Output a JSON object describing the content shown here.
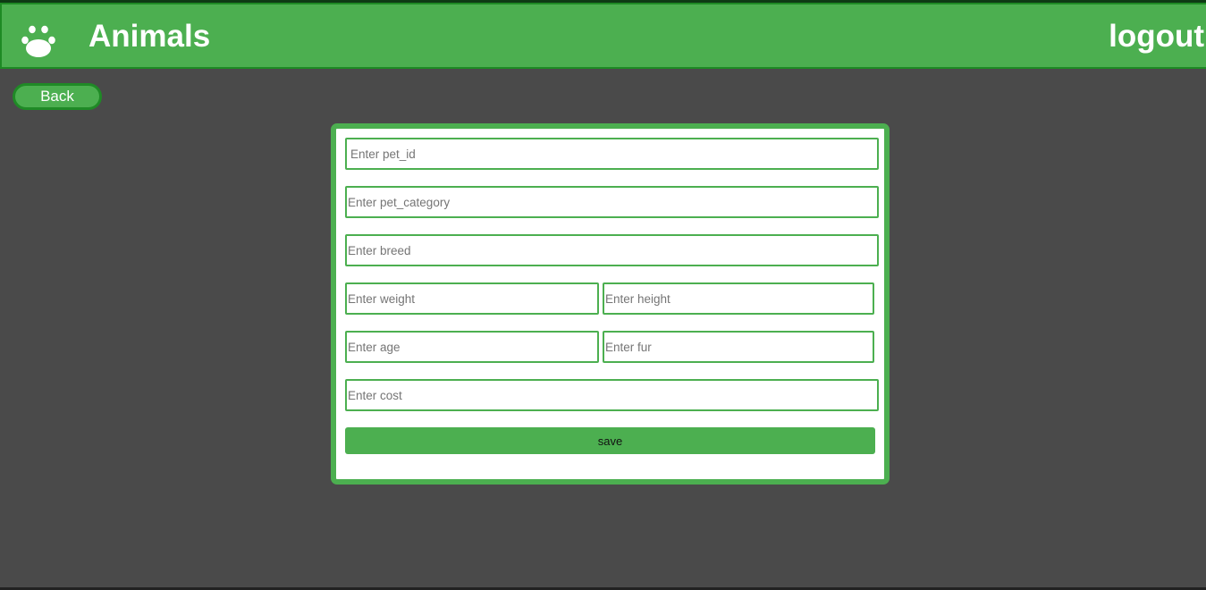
{
  "header": {
    "title": "Animals",
    "logo_icon": "paw-icon",
    "logout_label": "logout"
  },
  "back_label": "Back",
  "form": {
    "fields": {
      "pet_id": "Enter pet_id",
      "pet_category": "Enter pet_category",
      "breed": "Enter breed",
      "weight": "Enter weight",
      "height": "Enter height",
      "age": "Enter age",
      "fur": "Enter fur",
      "cost": "Enter cost"
    },
    "save_label": "save"
  },
  "colors": {
    "accent": "#4caf50",
    "accent_dark": "#1e8a24",
    "background": "#4a4a4a"
  }
}
